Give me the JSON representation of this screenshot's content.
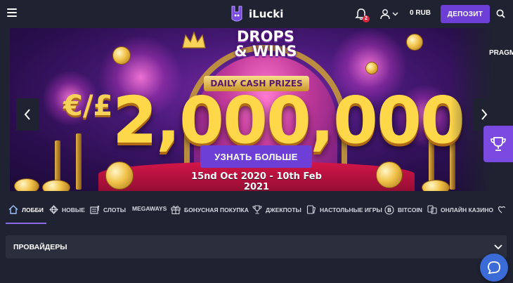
{
  "header": {
    "logo_text": "iLucki",
    "notifications_count": "2",
    "balance": "0 RUB",
    "deposit_label": "ДЕПОЗИТ"
  },
  "banner": {
    "headline_line1": "DROPS",
    "headline_line2": "& WINS",
    "ribbon": "DAILY CASH PRIZES",
    "currency": "€/£",
    "amount": "2,000,000",
    "cta_label": "УЗНАТЬ БОЛЬШЕ",
    "dates": "15nd Oct 2020 - 10th Feb 2021",
    "next_slide_peek": "PRAGM"
  },
  "categories": [
    {
      "label": "ЛОББИ",
      "icon": "home-icon",
      "active": true
    },
    {
      "label": "НОВЫЕ",
      "icon": "diamond-icon"
    },
    {
      "label": "СЛОТЫ",
      "icon": "slot-machine-icon"
    },
    {
      "label": "MEGAWAYS",
      "icon": ""
    },
    {
      "label": "БОНУСНАЯ ПОКУПКА",
      "icon": "gift-icon"
    },
    {
      "label": "ДЖЕКПОТЫ",
      "icon": "trophy-icon"
    },
    {
      "label": "НАСТОЛЬНЫЕ ИГРЫ",
      "icon": "cards-icon"
    },
    {
      "label": "BITCOIN",
      "icon": "bitcoin-icon"
    },
    {
      "label": "ОНЛАЙН КАЗИНО",
      "icon": "live-casino-icon"
    }
  ],
  "providers": {
    "label": "ПРОВАЙДЕРЫ"
  },
  "colors": {
    "background": "#1f2230",
    "accent": "#6d3fd6",
    "panel": "#2b2e3d",
    "chat": "#3a6bd6"
  }
}
